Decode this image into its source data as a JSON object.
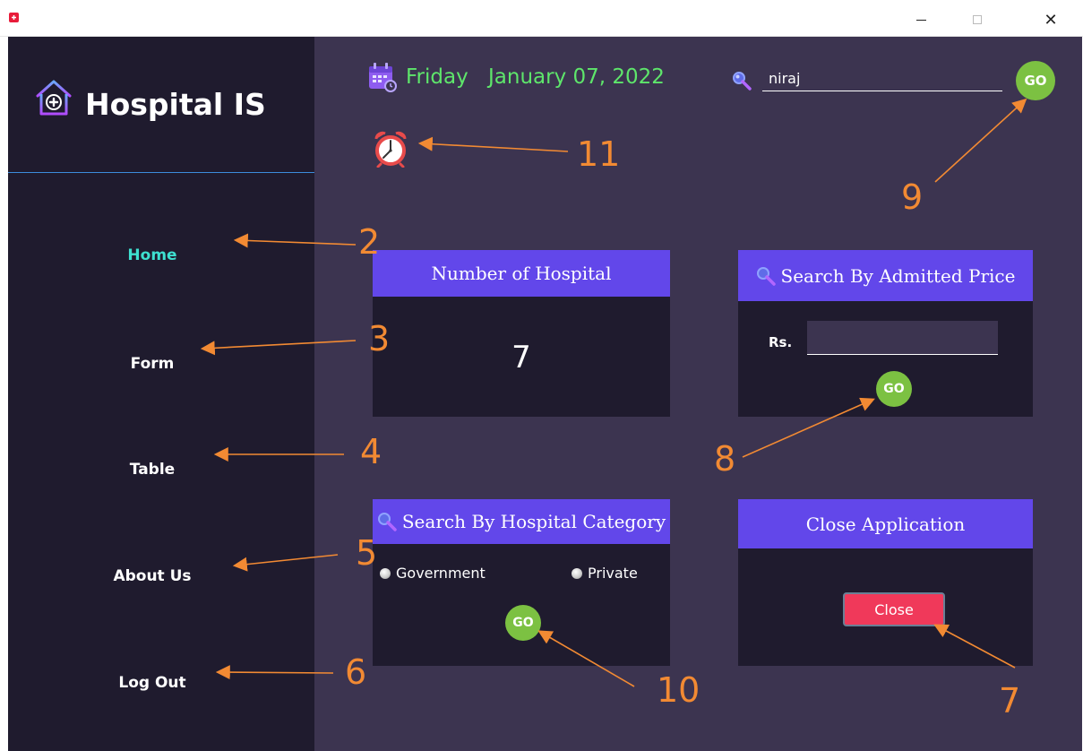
{
  "window": {
    "icon": "app-red-cross-icon",
    "controls": {
      "minimize": "minimize-icon",
      "maximize": "maximize-icon",
      "close": "close-x-icon",
      "close_glyph": "✕"
    }
  },
  "sidebar": {
    "logo_icon": "hospital-house-icon",
    "title": "Hospital IS",
    "nav": [
      {
        "label": "Home",
        "active": true
      },
      {
        "label": "Form"
      },
      {
        "label": "Table"
      },
      {
        "label": "About Us"
      },
      {
        "label": "Log Out"
      }
    ]
  },
  "header": {
    "calendar_icon": "calendar-icon",
    "day": "Friday",
    "date": "January 07, 2022",
    "search_icon": "search-icon",
    "search_value": "niraj",
    "go_label": "GO",
    "clock_icon": "alarm-clock-icon"
  },
  "cards": {
    "hospital_count": {
      "title": "Number of Hospital",
      "value": "7"
    },
    "admitted_price": {
      "title": "Search By Admitted Price",
      "currency_label": "Rs.",
      "input_value": "",
      "go_label": "GO"
    },
    "category": {
      "title": "Search By Hospital Category",
      "options": [
        "Government",
        "Private"
      ],
      "go_label": "GO"
    },
    "close_app": {
      "title": "Close Application",
      "button_label": "Close"
    }
  },
  "annotations": [
    "2",
    "3",
    "4",
    "5",
    "6",
    "7",
    "8",
    "9",
    "10",
    "11"
  ],
  "colors": {
    "sidebar_bg": "#1f1b2e",
    "main_bg": "#3c3450",
    "card_header": "#6247ea",
    "date_text": "#5ee66b",
    "nav_active": "#3ee0d0",
    "go_button": "#7cc142",
    "close_button": "#f0395a",
    "annotation": "#f28a33"
  }
}
